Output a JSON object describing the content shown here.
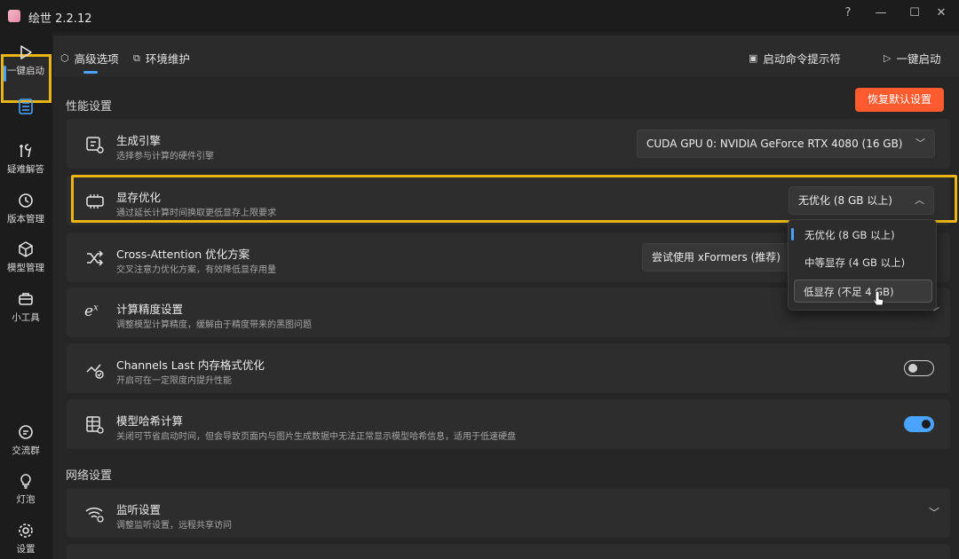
{
  "app": {
    "title": "绘世 2.2.12"
  },
  "window_controls": {
    "help": "?",
    "minimize": "—",
    "maximize": "☐",
    "close": "✕"
  },
  "sidebar": {
    "items": [
      {
        "label": "一键启动",
        "icon": "play-icon"
      },
      {
        "label": "",
        "icon": "list-settings-icon",
        "active": true
      },
      {
        "label": "疑难解答",
        "icon": "tools-icon"
      },
      {
        "label": "版本管理",
        "icon": "history-icon"
      },
      {
        "label": "模型管理",
        "icon": "box-icon"
      },
      {
        "label": "小工具",
        "icon": "toolbox-icon"
      },
      {
        "label": "交流群",
        "icon": "chat-icon"
      },
      {
        "label": "灯泡",
        "icon": "lightbulb-icon"
      },
      {
        "label": "设置",
        "icon": "gear-icon"
      }
    ]
  },
  "tabs": {
    "advanced": "高级选项",
    "env": "环境维护",
    "console": "启动命令提示符",
    "launch": "一键启动"
  },
  "performance": {
    "section_title": "性能设置",
    "reset_button": "恢复默认设置",
    "engine": {
      "title": "生成引擎",
      "desc": "选择参与计算的硬件引擎",
      "value": "CUDA GPU 0: NVIDIA GeForce RTX 4080 (16 GB)"
    },
    "vram": {
      "title": "显存优化",
      "desc": "通过延长计算时间换取更低显存上限要求",
      "value": "无优化 (8 GB 以上)"
    },
    "cross_attention": {
      "title": "Cross-Attention 优化方案",
      "desc": "交叉注意力优化方案，有效降低显存用量",
      "value": "尝试使用 xFormers (推荐)"
    },
    "precision": {
      "title": "计算精度设置",
      "desc": "调整模型计算精度，缓解由于精度带来的黑图问题"
    },
    "channels_last": {
      "title": "Channels Last 内存格式优化",
      "desc": "开启可在一定限度内提升性能",
      "enabled": false
    },
    "hash": {
      "title": "模型哈希计算",
      "desc": "关闭可节省启动时间，但会导致页面内与图片生成数据中无法正常显示模型哈希信息，适用于低速硬盘",
      "enabled": true
    }
  },
  "vram_dropdown": {
    "options": [
      "无优化 (8 GB 以上)",
      "中等显存 (4 GB 以上)",
      "低显存 (不足 4 GB)"
    ],
    "selected_index": 0,
    "hovered_index": 2
  },
  "network": {
    "section_title": "网络设置",
    "listen": {
      "title": "监听设置",
      "desc": "调整监听设置，远程共享访问"
    }
  },
  "colors": {
    "accent": "#4aa3ff",
    "highlight": "#e9b615",
    "reset": "#ff5b2e"
  }
}
